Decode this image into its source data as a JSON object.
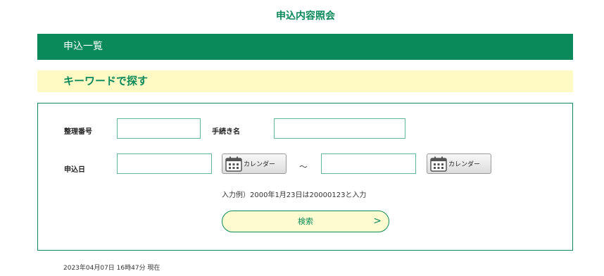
{
  "header": {
    "title": "申込内容照会"
  },
  "section": {
    "title": "申込一覧"
  },
  "keyword_section": {
    "title": "キーワードで探す"
  },
  "form": {
    "reference_number_label": "整理番号",
    "reference_number_value": "",
    "procedure_name_label": "手続き名",
    "procedure_name_value": "",
    "application_date_label": "申込日",
    "date_from_value": "",
    "date_to_value": "",
    "calendar_label": "カレンダー",
    "range_separator": "～",
    "example_text": "入力例）2000年1月23日は20000123と入力",
    "search_label": "検索",
    "search_arrow": ">"
  },
  "footer": {
    "timestamp": "2023年04月07日 16時47分 現在"
  },
  "colors": {
    "primary": "#0a8a5a",
    "highlight": "#fff9c4"
  },
  "icons": {
    "calendar": "calendar-icon",
    "arrow": "chevron-right-icon"
  }
}
